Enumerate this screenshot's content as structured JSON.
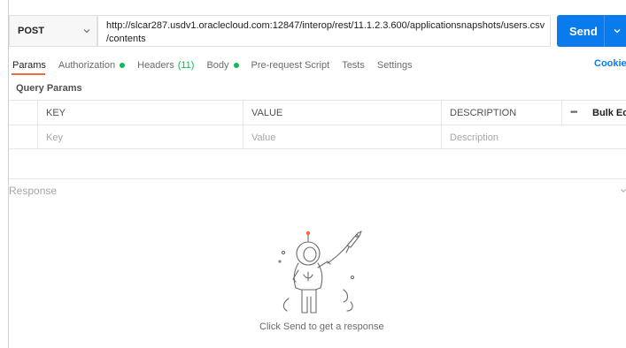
{
  "request": {
    "method": "POST",
    "url_line1": "http://slcar287.usdv1.oraclecloud.com:12847/interop/rest/11.1.2.3.600/applicationsnapshots/users.csv",
    "url_line2": "/contents",
    "send_label": "Send"
  },
  "tabs": [
    {
      "label": "Params",
      "active": true
    },
    {
      "label": "Authorization",
      "status_dot": true
    },
    {
      "label": "Headers",
      "count": "(11)"
    },
    {
      "label": "Body",
      "status_dot": true
    },
    {
      "label": "Pre-request Script"
    },
    {
      "label": "Tests"
    },
    {
      "label": "Settings"
    }
  ],
  "cookies_label": "Cookies",
  "query_params": {
    "title": "Query Params",
    "columns": {
      "key": "KEY",
      "value": "VALUE",
      "description": "DESCRIPTION",
      "more": "•••",
      "bulk_edit": "Bulk Edit"
    },
    "placeholders": {
      "key": "Key",
      "value": "Value",
      "description": "Description"
    }
  },
  "response": {
    "label": "Response",
    "empty_message": "Click Send to get a response"
  },
  "colors": {
    "send_blue": "#097bed",
    "active_tab_underline": "#f26b3a",
    "status_green": "#0cbb52"
  },
  "icons": [
    "chevron-down-icon",
    "astronaut-illustration",
    "rocket-illustration"
  ]
}
